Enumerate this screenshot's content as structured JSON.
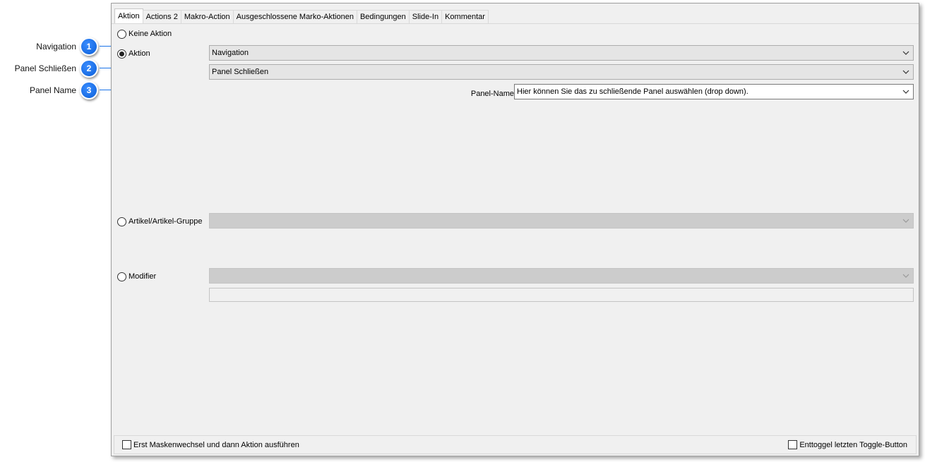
{
  "tabs": [
    {
      "label": "Aktion",
      "active": true
    },
    {
      "label": "Actions 2",
      "active": false
    },
    {
      "label": "Makro-Action",
      "active": false
    },
    {
      "label": "Ausgeschlossene Marko-Aktionen",
      "active": false
    },
    {
      "label": "Bedingungen",
      "active": false
    },
    {
      "label": "Slide-In",
      "active": false
    },
    {
      "label": "Kommentar",
      "active": false
    }
  ],
  "options": {
    "keine_aktion": "Keine Aktion",
    "aktion": "Aktion",
    "artikel": "Artikel/Artikel-Gruppe",
    "modifier": "Modifier"
  },
  "selected_option": "Aktion",
  "fields": {
    "navigation_value": "Navigation",
    "panel_value": "Panel Schließen",
    "panel_name_label": "Panel-Name",
    "panel_name_value": "Hier können Sie das zu schließende Panel auswählen (drop down).",
    "artikel_value": "",
    "modifier_value": "",
    "modifier_text": ""
  },
  "bottom": {
    "check_left": "Erst Maskenwechsel und dann Aktion ausführen",
    "check_right": "Enttoggel letzten Toggle-Button"
  },
  "callouts": [
    {
      "number": "1",
      "label": "Navigation"
    },
    {
      "number": "2",
      "label": "Panel Schließen"
    },
    {
      "number": "3",
      "label": "Panel Name"
    }
  ],
  "colors": {
    "badge": "#1a73e8",
    "leader": "#1a73e8",
    "window_bg": "#f0f0f0"
  },
  "icons": {
    "dropdown": "chevron-down-icon",
    "radio": "radio-button-icon",
    "checkbox": "checkbox-icon"
  }
}
